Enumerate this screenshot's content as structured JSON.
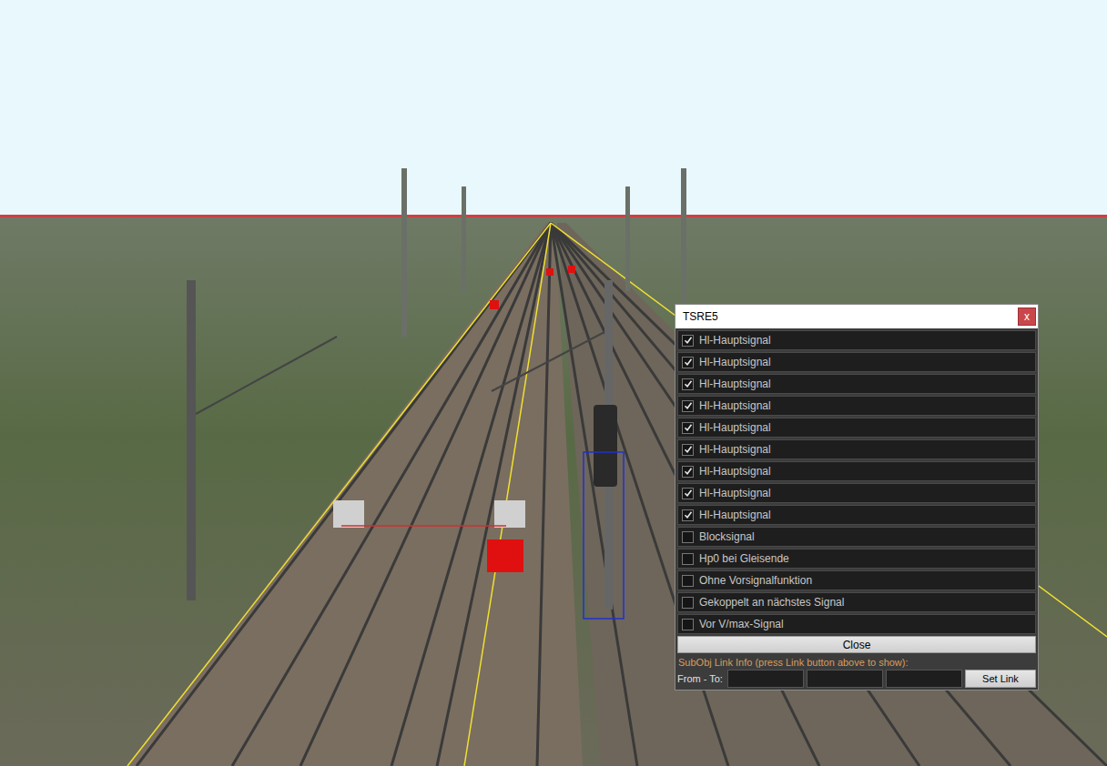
{
  "window": {
    "title": "TSRE5",
    "close_glyph": "x"
  },
  "options": [
    {
      "label": "Hl-Hauptsignal",
      "checked": true
    },
    {
      "label": "Hl-Hauptsignal",
      "checked": true
    },
    {
      "label": "Hl-Hauptsignal",
      "checked": true
    },
    {
      "label": "Hl-Hauptsignal",
      "checked": true
    },
    {
      "label": "Hl-Hauptsignal",
      "checked": true
    },
    {
      "label": "Hl-Hauptsignal",
      "checked": true
    },
    {
      "label": "Hl-Hauptsignal",
      "checked": true
    },
    {
      "label": "Hl-Hauptsignal",
      "checked": true
    },
    {
      "label": "Hl-Hauptsignal",
      "checked": true
    },
    {
      "label": "Blocksignal",
      "checked": false
    },
    {
      "label": "Hp0 bei Gleisende",
      "checked": false
    },
    {
      "label": "Ohne Vorsignalfunktion",
      "checked": false
    },
    {
      "label": "Gekoppelt an nächstes Signal",
      "checked": false
    },
    {
      "label": "Vor V/max-Signal",
      "checked": false
    }
  ],
  "close_button": "Close",
  "link_info": "SubObj Link Info (press Link button above to show):",
  "link_row": {
    "label": "From - To:",
    "fields": [
      "",
      "",
      ""
    ],
    "button": "Set Link"
  }
}
